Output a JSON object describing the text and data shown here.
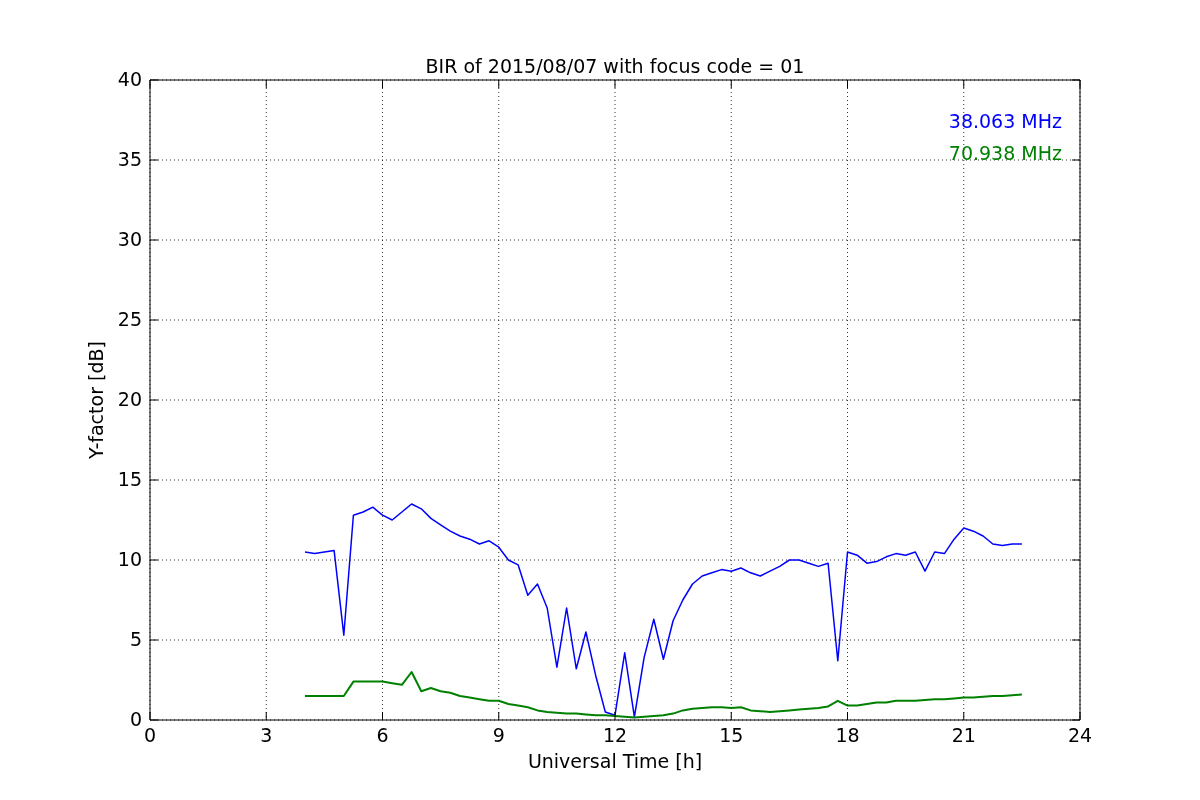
{
  "chart_data": {
    "type": "line",
    "title": "BIR of 2015/08/07 with focus code = 01",
    "xlabel": "Universal Time [h]",
    "ylabel": "Y-factor [dB]",
    "xlim": [
      0,
      24
    ],
    "ylim": [
      0,
      40
    ],
    "xticks": [
      0,
      3,
      6,
      9,
      12,
      15,
      18,
      21,
      24
    ],
    "yticks": [
      0,
      5,
      10,
      15,
      20,
      25,
      30,
      35,
      40
    ],
    "grid": true,
    "x": [
      4,
      4.25,
      4.5,
      4.75,
      5,
      5.25,
      5.5,
      5.75,
      6,
      6.25,
      6.5,
      6.75,
      7,
      7.25,
      7.5,
      7.75,
      8,
      8.25,
      8.5,
      8.75,
      9,
      9.25,
      9.5,
      9.75,
      10,
      10.25,
      10.5,
      10.75,
      11,
      11.25,
      11.5,
      11.75,
      12,
      12.25,
      12.5,
      12.75,
      13,
      13.25,
      13.5,
      13.75,
      14,
      14.25,
      14.5,
      14.75,
      15,
      15.25,
      15.5,
      15.75,
      16,
      16.25,
      16.5,
      16.75,
      17,
      17.25,
      17.5,
      17.75,
      18,
      18.25,
      18.5,
      18.75,
      19,
      19.25,
      19.5,
      19.75,
      20,
      20.25,
      20.5,
      20.75,
      21,
      21.25,
      21.5,
      21.75,
      22,
      22.25,
      22.5
    ],
    "series": [
      {
        "name": "38.063 MHz",
        "color": "#0000ff",
        "values": [
          10.5,
          10.4,
          10.5,
          10.6,
          5.3,
          12.8,
          13.0,
          13.3,
          12.8,
          12.5,
          13.0,
          13.5,
          13.2,
          12.6,
          12.2,
          11.8,
          11.5,
          11.3,
          11.0,
          11.2,
          10.8,
          10.0,
          9.7,
          7.8,
          8.5,
          7.0,
          3.3,
          7.0,
          3.2,
          5.5,
          2.8,
          0.5,
          0.3,
          4.2,
          0.2,
          3.9,
          6.3,
          3.8,
          6.2,
          7.5,
          8.5,
          9.0,
          9.2,
          9.4,
          9.3,
          9.5,
          9.2,
          9.0,
          9.3,
          9.6,
          10.0,
          10.0,
          9.8,
          9.6,
          9.8,
          3.7,
          10.5,
          10.3,
          9.8,
          9.9,
          10.2,
          10.4,
          10.3,
          10.5,
          9.3,
          10.5,
          10.4,
          11.3,
          12.0,
          11.8,
          11.5,
          11.0,
          10.9,
          11.0,
          11.0
        ]
      },
      {
        "name": "70.938 MHz",
        "color": "#008000",
        "values": [
          1.5,
          1.5,
          1.5,
          1.5,
          1.5,
          2.4,
          2.4,
          2.4,
          2.4,
          2.3,
          2.2,
          3.0,
          1.8,
          2.0,
          1.8,
          1.7,
          1.5,
          1.4,
          1.3,
          1.2,
          1.2,
          1.0,
          0.9,
          0.8,
          0.6,
          0.5,
          0.45,
          0.4,
          0.4,
          0.35,
          0.3,
          0.3,
          0.25,
          0.2,
          0.15,
          0.2,
          0.25,
          0.3,
          0.4,
          0.6,
          0.7,
          0.75,
          0.8,
          0.8,
          0.75,
          0.8,
          0.6,
          0.55,
          0.5,
          0.55,
          0.6,
          0.65,
          0.7,
          0.75,
          0.85,
          1.2,
          0.9,
          0.9,
          1.0,
          1.1,
          1.1,
          1.2,
          1.2,
          1.2,
          1.25,
          1.3,
          1.3,
          1.35,
          1.4,
          1.4,
          1.45,
          1.5,
          1.5,
          1.55,
          1.6
        ]
      }
    ]
  }
}
